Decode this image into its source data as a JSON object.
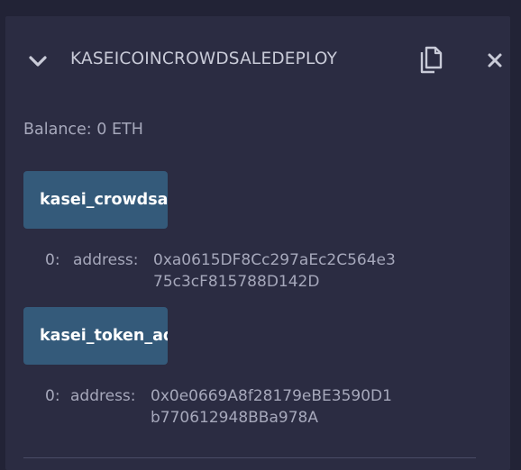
{
  "contract": {
    "title": "KASEICOINCROWDSALEDEPLOY",
    "balance": "Balance: 0 ETH"
  },
  "functions": [
    {
      "label": "kasei_crowdsale_address",
      "result_index": "0:",
      "result_label": "address:",
      "result_line1": "0xa0615DF8Cc297aEc2C564e3",
      "result_line2": "75c3cF815788D142D"
    },
    {
      "label": "kasei_token_address",
      "result_index": "0:",
      "result_label": "address:",
      "result_line1": "0x0e0669A8f28179eBE3590D1",
      "result_line2": "b770612948BBa978A"
    }
  ],
  "icons": {
    "expand": "chevron-down-icon",
    "copy": "copy-icon",
    "close": "close-icon"
  },
  "colors": {
    "background": "#222336",
    "panel": "#2b2c42",
    "button": "#345a7a",
    "text": "#a6a8bb"
  }
}
